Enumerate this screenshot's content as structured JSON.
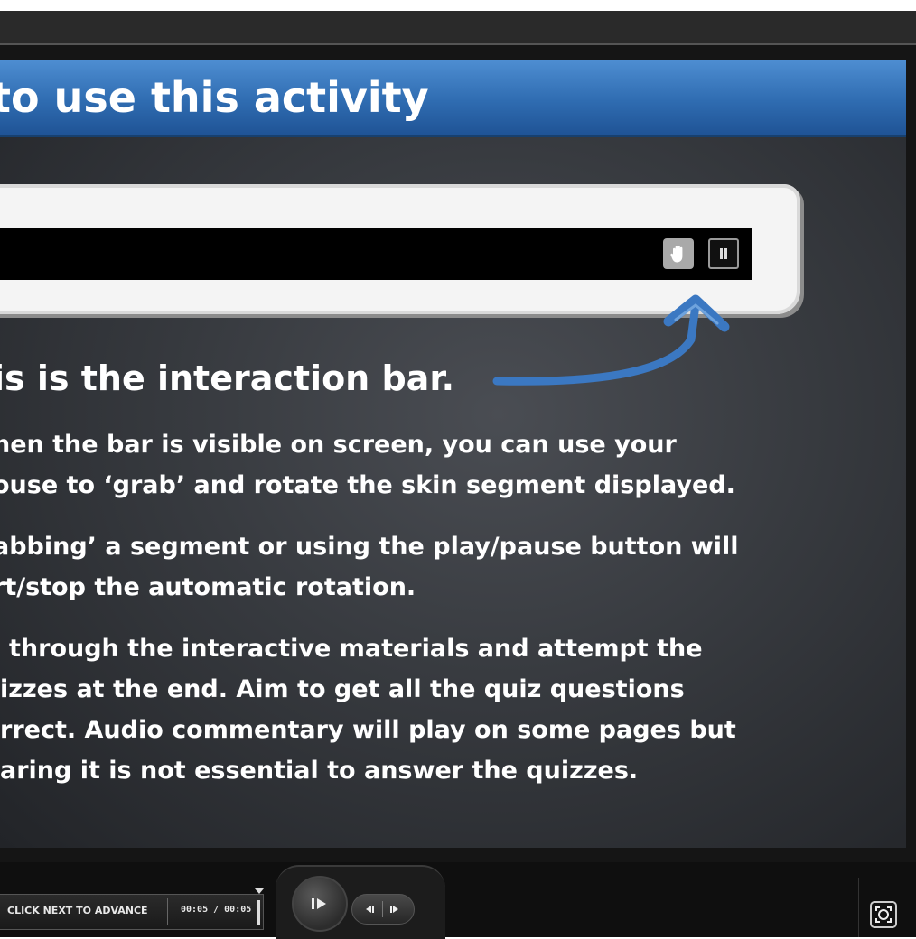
{
  "slide": {
    "title": "to use this activity",
    "heading": "is is the interaction bar.",
    "paragraphs": [
      {
        "lines": [
          "hen the bar is visible on screen, you can use your",
          "ouse to ‘grab’ and rotate the skin segment displayed."
        ]
      },
      {
        "lines": [
          "abbing’ a segment or using the play/pause button will",
          "rt/stop the automatic rotation."
        ]
      },
      {
        "lines": [
          "through the interactive materials and attempt the",
          "izzes at the end.  Aim to get all the quiz questions",
          "rrect. Audio commentary will play on some pages but",
          "aring it is not essential to answer the quizzes."
        ]
      }
    ],
    "example_bar": {
      "grab_icon": "hand-icon",
      "pause_icon": "pause-icon"
    },
    "arrow_color": "#3b78c2"
  },
  "player": {
    "status_label": "CLICK NEXT TO ADVANCE",
    "time": "00:05 / 00:05",
    "play_icon": "play-icon",
    "prev_icon": "previous-icon",
    "next_icon": "next-icon",
    "fullscreen_icon": "fullscreen-icon"
  },
  "colors": {
    "title_band": "#2f6cb1",
    "accent": "#4e8ed2"
  }
}
